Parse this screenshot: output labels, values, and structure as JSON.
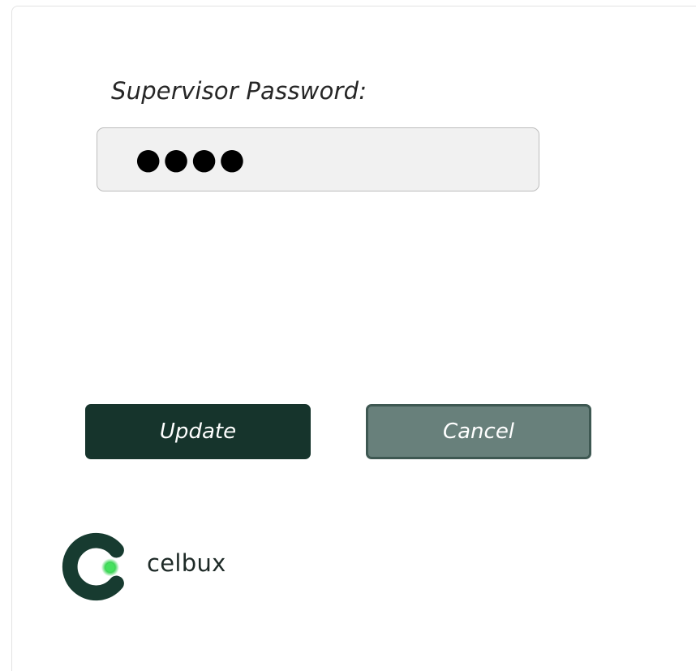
{
  "form": {
    "password_label": "Supervisor Password:",
    "password_masked": "●●●●"
  },
  "actions": {
    "update_label": "Update",
    "cancel_label": "Cancel"
  },
  "brand": {
    "name": "celbux",
    "primary_color": "#16342c",
    "accent_color": "#39d353",
    "logo_icon": "celbux-c-logo-icon"
  },
  "colors": {
    "update_button": "#16342c",
    "cancel_button": "#68807b",
    "input_background": "#f1f1f1"
  }
}
